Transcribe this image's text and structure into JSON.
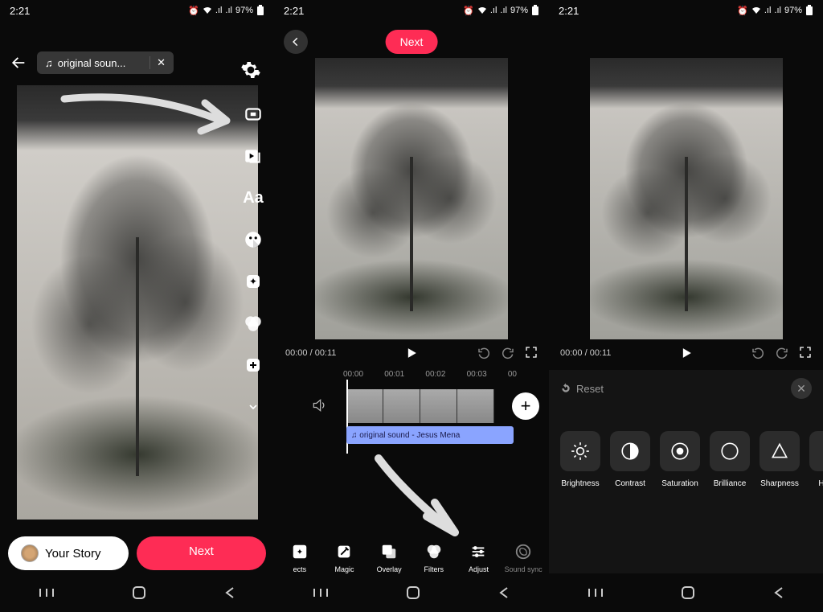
{
  "status": {
    "time": "2:21",
    "battery": "97%"
  },
  "panel1": {
    "sound_chip": "original soun...",
    "your_story": "Your Story",
    "next": "Next",
    "side_text": "Aa"
  },
  "panel2": {
    "next": "Next",
    "time": "00:00 / 00:11",
    "ticks": [
      "00:00",
      "00:01",
      "00:02",
      "00:03",
      "00"
    ],
    "audio_label": "♫ original sound - Jesus Mena",
    "tools": {
      "effects": "ects",
      "magic": "Magic",
      "overlay": "Overlay",
      "filters": "Filters",
      "adjust": "Adjust",
      "sound_sync": "Sound sync"
    }
  },
  "panel3": {
    "time": "00:00 / 00:11",
    "reset": "Reset",
    "adjust": {
      "brightness": "Brightness",
      "contrast": "Contrast",
      "saturation": "Saturation",
      "brilliance": "Brilliance",
      "sharpness": "Sharpness",
      "hue": "H"
    }
  }
}
